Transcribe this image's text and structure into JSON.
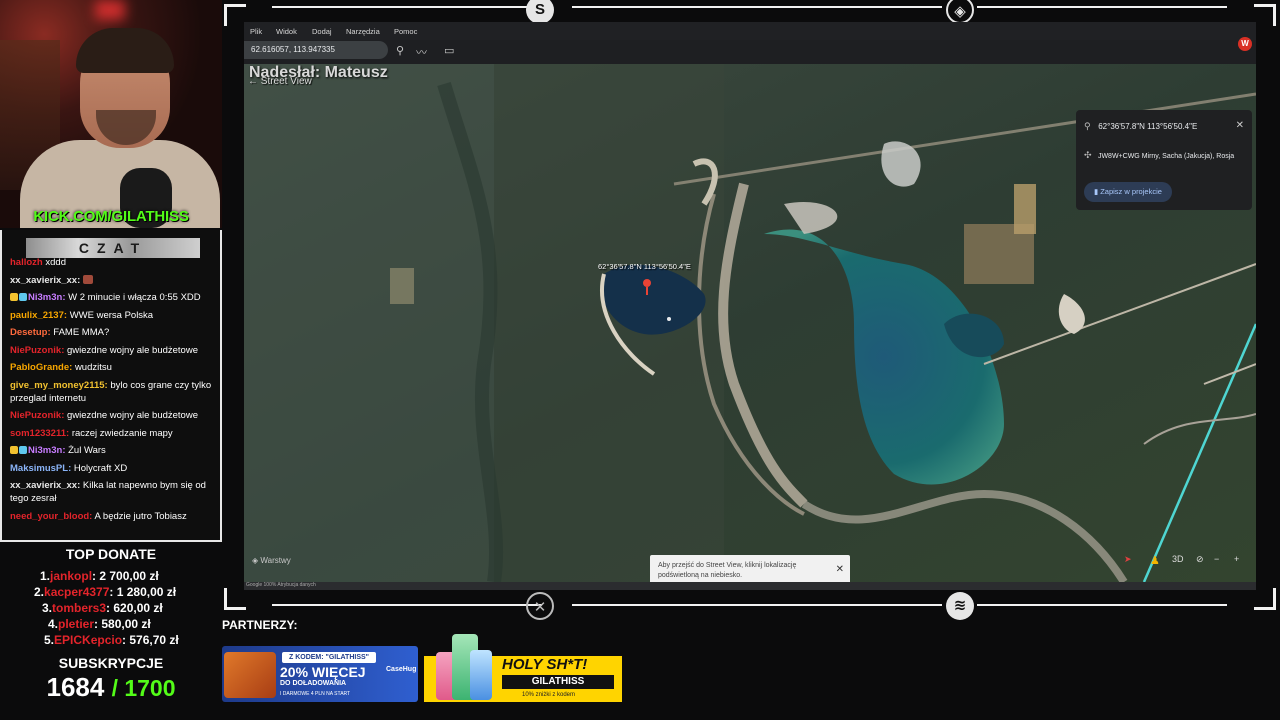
{
  "webcam": {
    "kick_link": "KICK.COM/GILATHISS"
  },
  "chat": {
    "title": "CZAT",
    "messages": [
      {
        "user": "hallozh",
        "text": "xddd",
        "color": "#e3242b",
        "badges": ""
      },
      {
        "user": "xx_xavierix_xx:",
        "text": "",
        "color": "#e8e8e8",
        "badges": "emote"
      },
      {
        "user": "Ni3m3n:",
        "text": "W 2 minucie i włącza 0:55 XDD",
        "color": "#c77dff",
        "badges": "crown"
      },
      {
        "user": "paulix_2137:",
        "text": "WWE wersa Polska",
        "color": "#f7a600",
        "badges": ""
      },
      {
        "user": "Desetup:",
        "text": "FAME MMA?",
        "color": "#ff6a3d",
        "badges": ""
      },
      {
        "user": "NiePuzonik:",
        "text": "gwiezdne wojny ale budżetowe",
        "color": "#e3242b",
        "badges": ""
      },
      {
        "user": "PabloGrande:",
        "text": "wudzitsu",
        "color": "#f7a600",
        "badges": ""
      },
      {
        "user": "give_my_money2115:",
        "text": "bylo cos grane czy tylko przeglad internetu",
        "color": "#f2c230",
        "badges": ""
      },
      {
        "user": "NiePuzonik:",
        "text": "gwiezdne wojny ale budżetowe",
        "color": "#e3242b",
        "badges": ""
      },
      {
        "user": "som1233211:",
        "text": "raczej zwiedzanie mapy",
        "color": "#e3242b",
        "badges": ""
      },
      {
        "user": "Ni3m3n:",
        "text": "Żul Wars",
        "color": "#c77dff",
        "badges": "crown"
      },
      {
        "user": "MaksimusPL:",
        "text": "Holycraft XD",
        "color": "#8ab4f8",
        "badges": ""
      },
      {
        "user": "xx_xavierix_xx:",
        "text": "Kilka lat napewno bym się od tego zesrał",
        "color": "#e8e8e8",
        "badges": ""
      },
      {
        "user": "need_your_blood:",
        "text": "A będzie jutro Tobiasz",
        "color": "#e3242b",
        "badges": ""
      }
    ]
  },
  "top_donate": {
    "title": "TOP DONATE",
    "rows": [
      {
        "rank": "1.",
        "name": "jankopl",
        "amount": ": 2 700,00 zł"
      },
      {
        "rank": "2.",
        "name": "kacper4377",
        "amount": ": 1 280,00 zł"
      },
      {
        "rank": "3.",
        "name": "tombers3",
        "amount": ": 620,00 zł"
      },
      {
        "rank": "4.",
        "name": "pletier",
        "amount": ": 580,00 zł"
      },
      {
        "rank": "5.",
        "name": "EPICKepcio",
        "amount": ": 576,70 zł"
      }
    ]
  },
  "subs": {
    "title": "SUBSKRYPCJE",
    "count": "1684",
    "goal": "/ 1700"
  },
  "google_earth": {
    "menu": [
      "Plik",
      "Widok",
      "Dodaj",
      "Narzędzia",
      "Pomoc"
    ],
    "avatar": "W",
    "search_value": "62.616057, 113.947335",
    "overlay_title": "Nadesłał: Mateusz",
    "street_view_label": "Street View",
    "pin_label": "62°36'57.8\"N 113°56'50.4\"E",
    "info": {
      "coords": "62°36'57.8\"N 113°56'50.4\"E",
      "plus_code": "JW8W+CWG Mirny, Sacha (Jakucja), Rosja",
      "save": "Zapisz w projekcie"
    },
    "tip_text": "Aby przejść do Street View, kliknij lokalizację podświetloną na niebiesko.",
    "layers": "Warstwy",
    "view_mode": "3D",
    "bottom_left": "Google   100%   Atrybucja danych"
  },
  "partners": {
    "title": "PARTNERZY:",
    "casehug": {
      "code": "Z KODEM: \"GILATHISS\"",
      "big": "20% WIĘCEJ",
      "line2": "DO DOŁADOWANIA",
      "line3": "I DARMOWE 4 PLN NA START",
      "brand": "CaseHug"
    },
    "holy": {
      "headline": "HOLY SH*T!",
      "code": "GILATHISS",
      "discount": "10% zniżki z kodem"
    }
  },
  "colors": {
    "kick_green": "#53fc18",
    "donate_red": "#e3242b",
    "frame": "#f2f2f2"
  }
}
